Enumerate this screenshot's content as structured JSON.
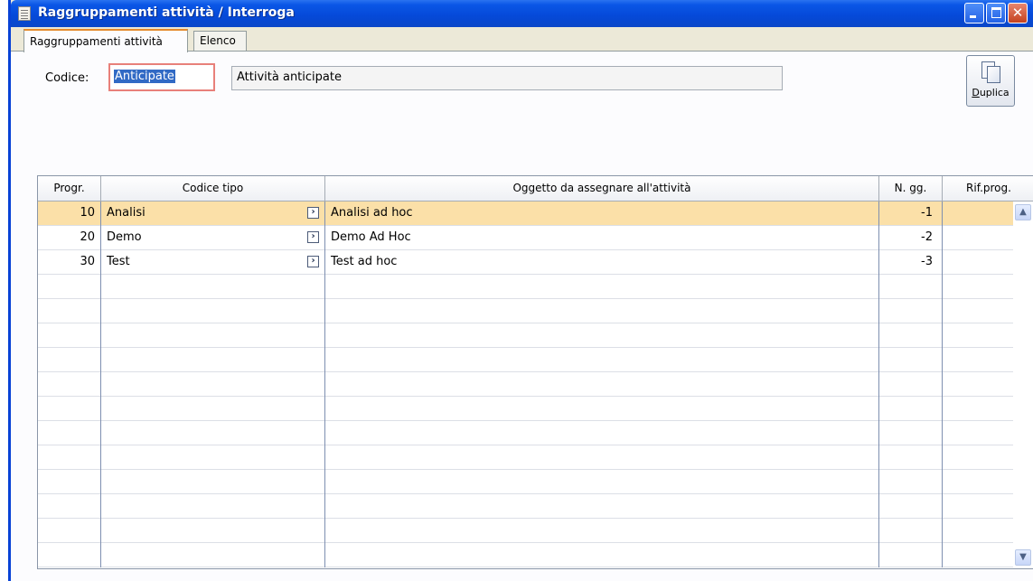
{
  "window": {
    "title": "Raggruppamenti attività / Interroga"
  },
  "tabs": [
    {
      "label": "Raggruppamenti attività",
      "active": true
    },
    {
      "label": "Elenco",
      "active": false
    }
  ],
  "form": {
    "codice_label": "Codice:",
    "codice_value": "Anticipate",
    "descrizione_value": "Attività anticipate",
    "duplica_prefix": "D",
    "duplica_rest": "uplica"
  },
  "grid": {
    "columns": [
      "Progr.",
      "Codice tipo",
      "Oggetto da assegnare all'attività",
      "N. gg.",
      "Rif.prog."
    ],
    "rows": [
      {
        "progr": "10",
        "tipo": "Analisi",
        "oggetto": "Analisi ad hoc",
        "ngg": "-1",
        "rif": ""
      },
      {
        "progr": "20",
        "tipo": "Demo",
        "oggetto": "Demo Ad Hoc",
        "ngg": "-2",
        "rif": ""
      },
      {
        "progr": "30",
        "tipo": "Test",
        "oggetto": "Test ad hoc",
        "ngg": "-3",
        "rif": ""
      }
    ],
    "selected_row": 0
  },
  "colors": {
    "titlebar": "#0549d8",
    "selected_row": "#fbe0a8",
    "active_tab_accent": "#e68b2c",
    "focused_field_border": "#e8807a"
  }
}
